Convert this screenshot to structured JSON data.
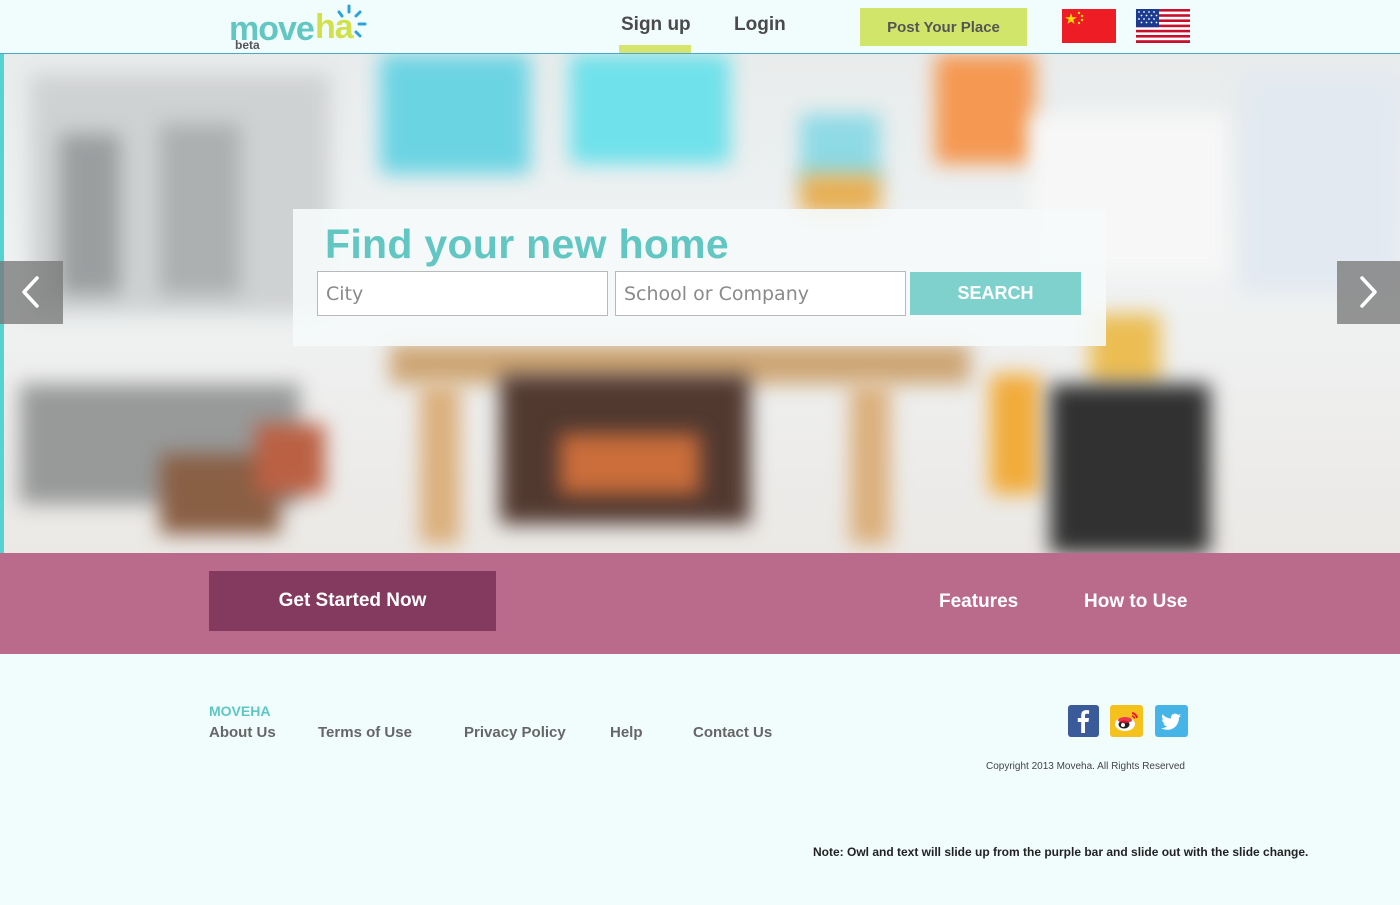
{
  "header": {
    "logo_part1": "move",
    "logo_part2": "ha",
    "logo_badge": "beta",
    "signup_label": "Sign up",
    "login_label": "Login",
    "post_button": "Post Your Place",
    "languages": [
      "chinese-flag",
      "us-flag"
    ]
  },
  "hero": {
    "title": "Find your new home",
    "city_placeholder": "City",
    "school_placeholder": "School or Company",
    "search_button": "SEARCH",
    "prev_icon": "chevron-left-icon",
    "next_icon": "chevron-right-icon"
  },
  "bar": {
    "cta_button": "Get Started Now",
    "links": [
      "Features",
      "How to Use"
    ]
  },
  "footer": {
    "brand": "MOVEHA",
    "links": [
      "About Us",
      "Terms of Use",
      "Privacy Policy",
      "Help",
      "Contact Us"
    ],
    "social": [
      "facebook-icon",
      "weibo-icon",
      "twitter-icon"
    ],
    "copyright": "Copyright 2013 Moveha.  All Rights Reserved",
    "note": "Note: Owl and text  will slide up from the purple bar and slide out with the slide change."
  },
  "colors": {
    "brand_teal": "#62c6c3",
    "brand_lime": "#d2e56b",
    "bar_purple": "#ba6a8b",
    "cta_purple": "#843a5e",
    "page_bg": "#f1fdfd"
  }
}
